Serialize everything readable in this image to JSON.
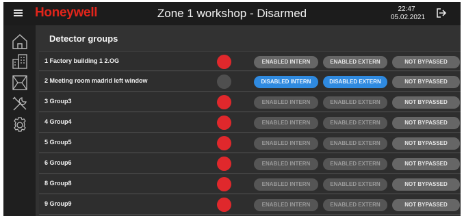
{
  "header": {
    "brand": "Honeywell",
    "title": "Zone 1 workshop - Disarmed",
    "time": "22:47",
    "date": "05.02.2021"
  },
  "sidebar": {
    "items": [
      "home-icon",
      "buildings-icon",
      "window-icon",
      "tools-icon",
      "settings-icon"
    ]
  },
  "main": {
    "section_title": "Detector groups",
    "groups": [
      {
        "label": "1 Factory building 1 2.OG",
        "status": "active",
        "intern": "ENABLED INTERN",
        "extern": "ENABLED EXTERN",
        "bypass": "NOT BYPASSED"
      },
      {
        "label": "2 Meeting room madrid left window",
        "status": "inactive",
        "intern": "DISABLED INTERN",
        "extern": "DISABLED EXTERN",
        "bypass": "NOT BYPASSED"
      },
      {
        "label": "3 Group3",
        "status": "active",
        "intern": "ENABLED INTERN",
        "extern": "ENABLED EXTERN",
        "bypass": "NOT BYPASSED"
      },
      {
        "label": "4 Group4",
        "status": "active",
        "intern": "ENABLED INTERN",
        "extern": "ENABLED EXTERN",
        "bypass": "NOT BYPASSED"
      },
      {
        "label": "5 Group5",
        "status": "active",
        "intern": "ENABLED INTERN",
        "extern": "ENABLED EXTERN",
        "bypass": "NOT BYPASSED"
      },
      {
        "label": "6 Group6",
        "status": "active",
        "intern": "ENABLED INTERN",
        "extern": "ENABLED EXTERN",
        "bypass": "NOT BYPASSED"
      },
      {
        "label": "8 Group8",
        "status": "active",
        "intern": "ENABLED INTERN",
        "extern": "ENABLED EXTERN",
        "bypass": "NOT BYPASSED"
      },
      {
        "label": "9 Group9",
        "status": "active",
        "intern": "ENABLED INTERN",
        "extern": "ENABLED EXTERN",
        "bypass": "NOT BYPASSED"
      }
    ]
  },
  "colors": {
    "brand_red": "#e1251b",
    "status_active": "#e0282c",
    "status_inactive": "#4f4f4f",
    "disabled_blue": "#2f8ae0"
  }
}
